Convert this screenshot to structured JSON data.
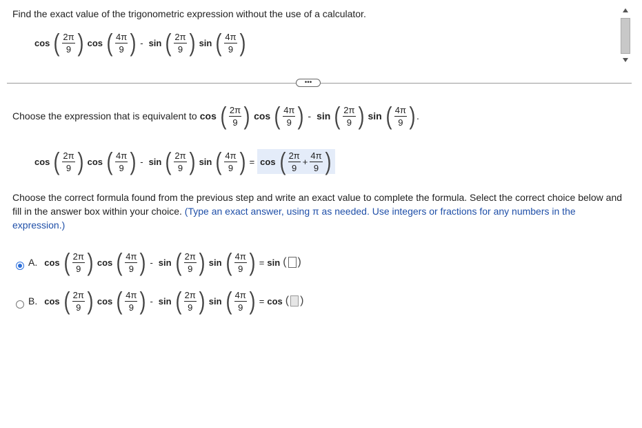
{
  "question": {
    "prompt": "Find the exact value of the trigonometric expression without the use of a calculator.",
    "expression": {
      "fn1": "cos",
      "num1": "2π",
      "den1": "9",
      "fn2": "cos",
      "num2": "4π",
      "den2": "9",
      "minus": "-",
      "fn3": "sin",
      "num3": "2π",
      "den3": "9",
      "fn4": "sin",
      "num4": "4π",
      "den4": "9"
    }
  },
  "more_button": "•••",
  "step1": {
    "prompt": "Choose the expression that is equivalent to",
    "period": ".",
    "result": {
      "equals": "=",
      "fn": "cos",
      "num_a": "2π",
      "den_a": "9",
      "plus": "+",
      "num_b": "4π",
      "den_b": "9"
    }
  },
  "step2": {
    "prompt_black": "Choose the correct formula found from the previous step and write an exact value to complete the formula. Select the correct choice below and fill in the answer box within your choice.",
    "prompt_blue": "(Type an exact answer, using π as needed. Use integers or fractions for any numbers in the expression.)",
    "choices": [
      {
        "letter": "A.",
        "selected": true,
        "equals": "=",
        "result_fn": "sin"
      },
      {
        "letter": "B.",
        "selected": false,
        "equals": "=",
        "result_fn": "cos"
      }
    ]
  },
  "colors": {
    "accent": "#2a6edb",
    "instruction_blue": "#1f4fa8",
    "highlight": "#e4ecf9"
  }
}
